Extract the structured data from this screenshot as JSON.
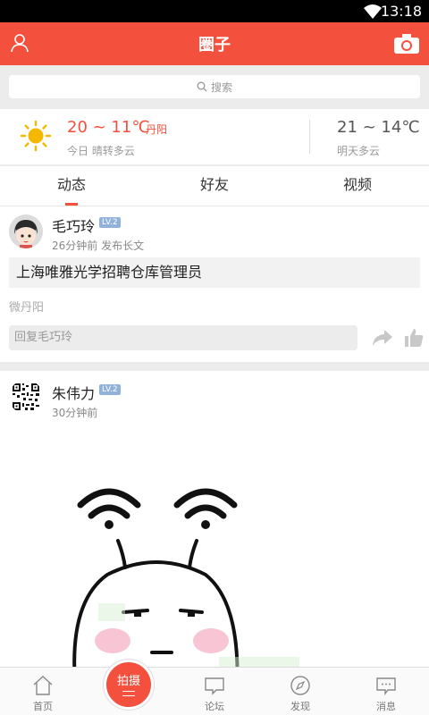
{
  "status_bar": {
    "time": "13:18"
  },
  "header": {
    "title": "圈子"
  },
  "search": {
    "placeholder": "搜索"
  },
  "weather": {
    "today_temp": "20 ~ 11℃",
    "city": "丹阳",
    "today_desc": "今日 晴转多云",
    "tomorrow_temp": "21 ~ 14℃",
    "tomorrow_desc": "明天多云"
  },
  "tabs": [
    {
      "label": "动态",
      "active": true
    },
    {
      "label": "好友",
      "active": false
    },
    {
      "label": "视频",
      "active": false
    }
  ],
  "posts": [
    {
      "username": "毛巧玲",
      "level": "LV.2",
      "meta": "26分钟前  发布长文",
      "title": "上海唯雅光学招聘仓库管理员",
      "source": "微丹阳",
      "reply_placeholder": "回复毛巧玲"
    },
    {
      "username": "朱伟力",
      "level": "LV.2",
      "meta": "30分钟前"
    }
  ],
  "bottom_nav": {
    "items": [
      "首页",
      "论坛",
      "发现",
      "消息"
    ],
    "shoot_label": "拍摄"
  },
  "colors": {
    "accent": "#f4503e",
    "level_badge": "#8fb1da"
  }
}
